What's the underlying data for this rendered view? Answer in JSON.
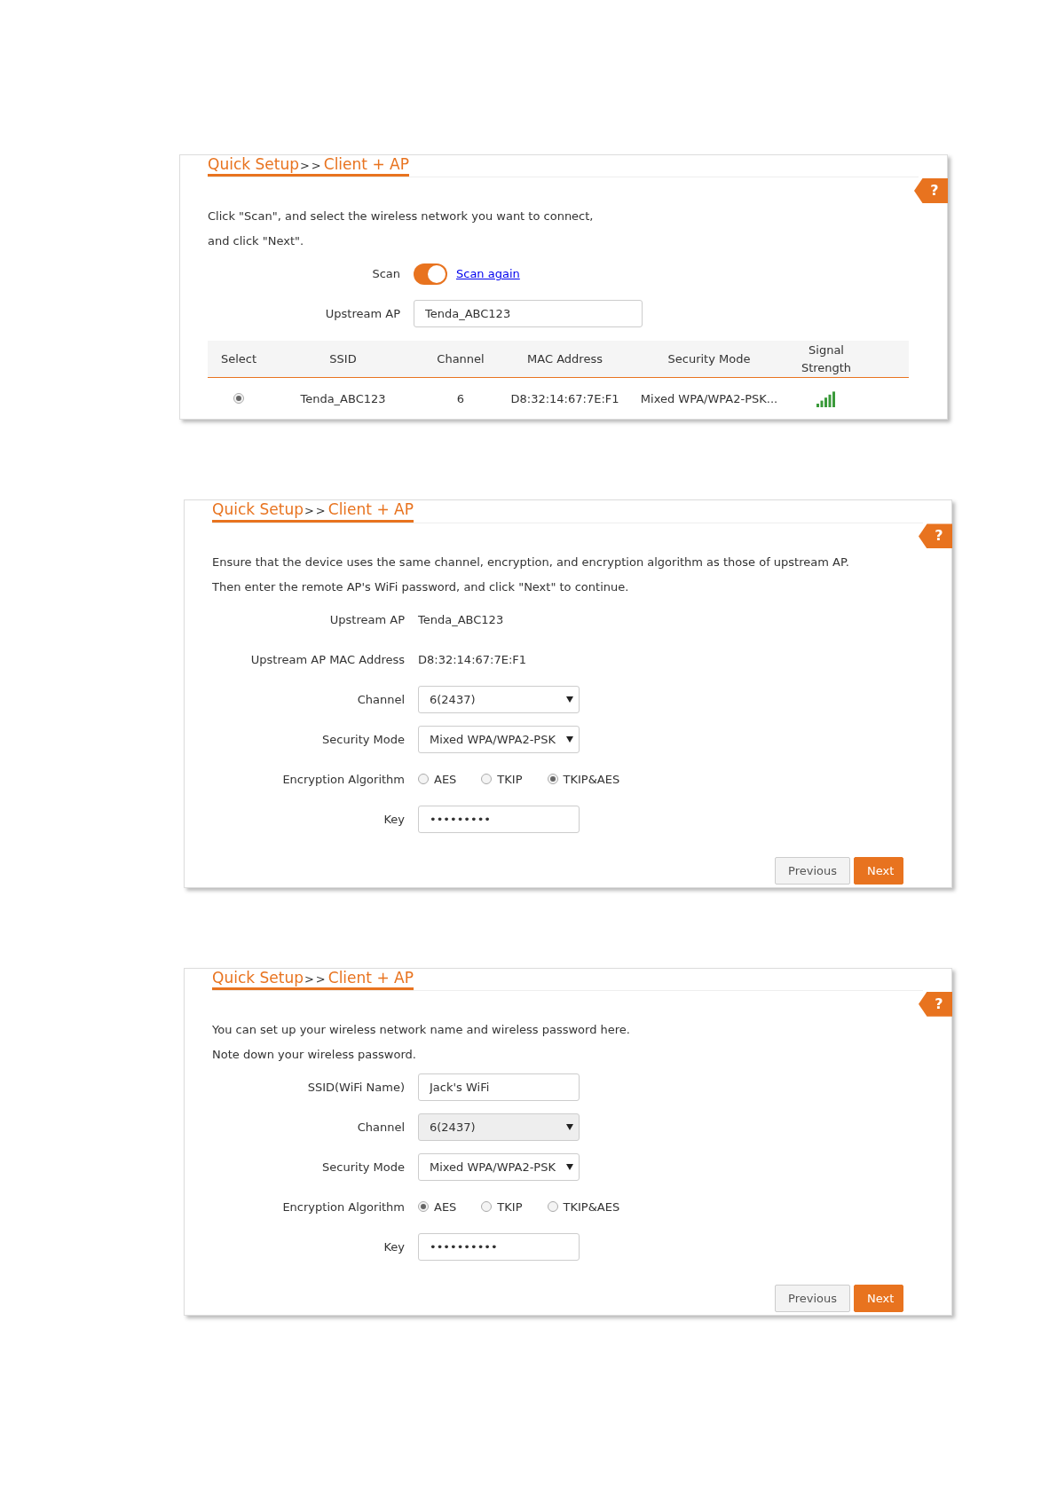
{
  "panels": [
    {
      "breadcrumb": {
        "parent": "Quick Setup",
        "separator": ">>",
        "current": "Client + AP"
      },
      "help": "?",
      "instructions": [
        "Click \"Scan\", and select the wireless network you want to connect,",
        "and click \"Next\"."
      ],
      "fields": [
        {
          "kind": "toggle",
          "label": "Scan",
          "on": true,
          "link": "Scan again"
        },
        {
          "kind": "input",
          "label": "Upstream AP",
          "value": "Tenda_ABC123"
        }
      ],
      "table": {
        "columns": [
          "Select",
          "SSID",
          "Channel",
          "MAC Address",
          "Security Mode",
          "Signal Strength"
        ],
        "rows": [
          {
            "selected": true,
            "ssid": "Tenda_ABC123",
            "channel": "6",
            "mac": "D8:32:14:67:7E:F1",
            "security": "Mixed WPA/WPA2-PSK..."
          }
        ]
      }
    },
    {
      "breadcrumb": {
        "parent": "Quick Setup",
        "separator": ">>",
        "current": "Client + AP"
      },
      "help": "?",
      "instructions": [
        "Ensure that the device uses the same channel, encryption, and encryption algorithm as those of upstream AP.",
        "Then enter the remote AP's WiFi password, and click \"Next\" to continue."
      ],
      "fields": [
        {
          "kind": "text",
          "label": "Upstream AP",
          "value": "Tenda_ABC123"
        },
        {
          "kind": "text",
          "label": "Upstream AP MAC Address",
          "value": "D8:32:14:67:7E:F1"
        },
        {
          "kind": "select",
          "label": "Channel",
          "value": "6(2437)",
          "disabled": false
        },
        {
          "kind": "select",
          "label": "Security Mode",
          "value": "Mixed WPA/WPA2-PSK",
          "disabled": false
        },
        {
          "kind": "radio",
          "label": "Encryption Algorithm",
          "options": [
            {
              "label": "AES",
              "selected": false
            },
            {
              "label": "TKIP",
              "selected": false
            },
            {
              "label": "TKIP&AES",
              "selected": true
            }
          ]
        },
        {
          "kind": "input",
          "label": "Key",
          "value": "•••••••••"
        }
      ],
      "buttons": [
        {
          "label": "Previous",
          "kind": "secondary"
        },
        {
          "label": "Next",
          "kind": "primary"
        }
      ]
    },
    {
      "breadcrumb": {
        "parent": "Quick Setup",
        "separator": ">>",
        "current": "Client + AP"
      },
      "help": "?",
      "instructions": [
        "You can set up your wireless network name and wireless password here.",
        "Note down your wireless password."
      ],
      "fields": [
        {
          "kind": "input",
          "label": "SSID(WiFi Name)",
          "value": "Jack's WiFi"
        },
        {
          "kind": "select",
          "label": "Channel",
          "value": "6(2437)",
          "disabled": true
        },
        {
          "kind": "select",
          "label": "Security Mode",
          "value": "Mixed WPA/WPA2-PSK",
          "disabled": false
        },
        {
          "kind": "radio",
          "label": "Encryption Algorithm",
          "options": [
            {
              "label": "AES",
              "selected": true
            },
            {
              "label": "TKIP",
              "selected": false
            },
            {
              "label": "TKIP&AES",
              "selected": false
            }
          ]
        },
        {
          "kind": "input",
          "label": "Key",
          "value": "••••••••••"
        }
      ],
      "buttons": [
        {
          "label": "Previous",
          "kind": "secondary"
        },
        {
          "label": "Next",
          "kind": "primary"
        }
      ]
    }
  ]
}
